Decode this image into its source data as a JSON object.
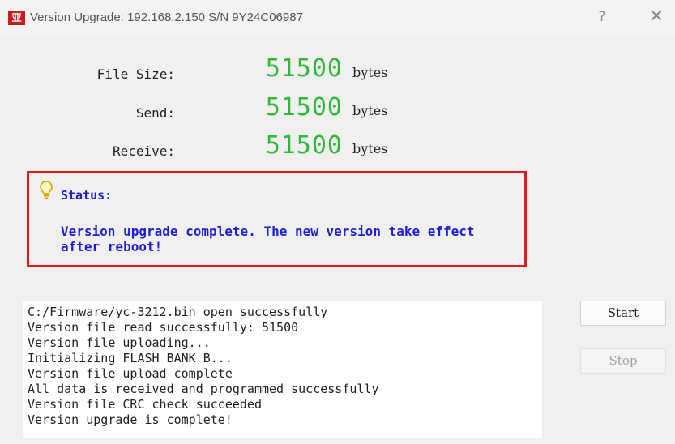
{
  "window": {
    "title": "Version Upgrade: 192.168.2.150  S/N 9Y24C06987",
    "icon_text": "亚",
    "help_glyph": "?",
    "close_glyph": "✕"
  },
  "counters": [
    {
      "label": "File Size:",
      "value": "51500",
      "unit": "bytes"
    },
    {
      "label": "Send:",
      "value": "51500",
      "unit": "bytes"
    },
    {
      "label": "Receive:",
      "value": "51500",
      "unit": "bytes"
    }
  ],
  "status": {
    "title": "Status:",
    "message": "Version upgrade complete. The new version take effect after reboot!",
    "border_color": "#e0191f",
    "text_color": "#1e1ed6"
  },
  "log_lines": [
    "C:/Firmware/yc-3212.bin open successfully",
    "Version file read successfully: 51500",
    "Version file uploading...",
    "Initializing FLASH BANK B...",
    "Version file upload complete",
    "All data is received and programmed successfully",
    "Version file CRC check succeeded",
    "Version upgrade is complete!"
  ],
  "buttons": {
    "start": "Start",
    "stop": "Stop"
  },
  "colors": {
    "digits": "#2fb838"
  },
  "icons": {
    "status": "lightbulb-icon",
    "app": "app-icon"
  }
}
